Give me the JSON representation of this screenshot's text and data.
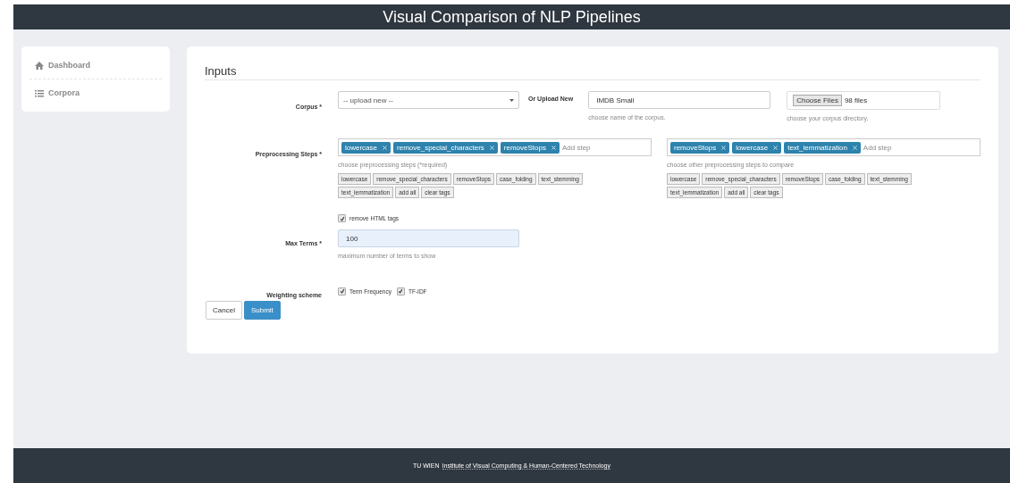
{
  "header": {
    "title": "Visual Comparison of NLP Pipelines"
  },
  "sidebar": {
    "items": [
      {
        "label": "Dashboard",
        "kind": "home"
      },
      {
        "label": "Corpora",
        "kind": "list"
      }
    ]
  },
  "form": {
    "title": "Inputs",
    "corpus": {
      "label": "Corpus *",
      "select_value": "-- upload new --",
      "upload_label": "Or Upload New",
      "name_value": "IMDB Small",
      "name_help": "choose name of the corpus.",
      "file_button": "Choose Files",
      "file_status": "98 files",
      "file_help": "choose your corpus directory."
    },
    "preprocessing": {
      "label": "Preprocessing Steps *",
      "groups": [
        {
          "tags": [
            "lowercase",
            "remove_special_characters",
            "removeStops"
          ],
          "placeholder": "Add step",
          "help": "choose preprocessing steps (*required)",
          "options": [
            "lowercase",
            "remove_special_characters",
            "removeStops",
            "case_folding",
            "text_stemming",
            "text_lemmatization",
            "add all",
            "clear tags"
          ]
        },
        {
          "tags": [
            "removeStops",
            "lowercase",
            "text_lemmatization"
          ],
          "placeholder": "Add step",
          "help": "choose other preprocessing steps to compare",
          "options": [
            "lowercase",
            "remove_special_characters",
            "removeStops",
            "case_folding",
            "text_stemming",
            "text_lemmatization",
            "add all",
            "clear tags"
          ]
        }
      ]
    },
    "remove_html": {
      "label": "remove HTML tags",
      "checked": true
    },
    "max_terms": {
      "label": "Max Terms *",
      "value": "100",
      "help": "maximum number of terms to show"
    },
    "weighting": {
      "label": "Weighting scheme",
      "options": [
        {
          "label": "Term Frequency",
          "checked": true
        },
        {
          "label": "TF-IDF",
          "checked": true
        }
      ]
    },
    "buttons": [
      {
        "label": "Cancel",
        "kind": "default"
      },
      {
        "label": "Submit",
        "kind": "primary"
      }
    ]
  },
  "footer": {
    "org": "TU WIEN",
    "link": "Institute of Visual Computing & Human-Centered Technology"
  }
}
